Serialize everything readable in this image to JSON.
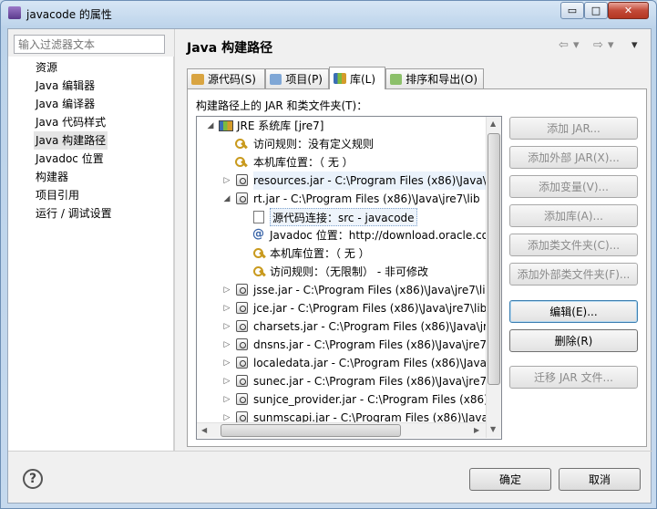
{
  "window": {
    "title": "javacode 的属性",
    "min_glyph": "▭",
    "max_glyph": "□",
    "close_glyph": "✕"
  },
  "filter": {
    "placeholder": "输入过滤器文本"
  },
  "nav": {
    "items": [
      "资源",
      "Java 编辑器",
      "Java 编译器",
      "Java 代码样式",
      "Java 构建路径",
      "Javadoc 位置",
      "构建器",
      "项目引用",
      "运行 / 调试设置"
    ],
    "selected": "Java 构建路径"
  },
  "page": {
    "title": "Java 构建路径",
    "back_glyph": "⇦",
    "fwd_glyph": "⇨",
    "menu_glyph": "▾"
  },
  "tabs": [
    "源代码(S)",
    "项目(P)",
    "库(L)",
    "排序和导出(O)"
  ],
  "active_tab": "库(L)",
  "libraries": {
    "label": "构建路径上的 JAR 和类文件夹(T)：",
    "jre": "JRE 系统库 [jre7]",
    "jre_access": "访问规则：没有定义规则",
    "jre_native": "本机库位置：（ 无 ）",
    "resources": "resources.jar  -  C:\\Program Files (x86)\\Java\\",
    "rt": "rt.jar  -  C:\\Program Files (x86)\\Java\\jre7\\lib",
    "rt_src": "源代码连接：src  -  javacode",
    "rt_javadoc": "Javadoc 位置：http://download.oracle.co",
    "rt_native": "本机库位置：（ 无 ）",
    "rt_access": "访问规则：（无限制）  -  非可修改",
    "jars": [
      "jsse.jar  -  C:\\Program Files (x86)\\Java\\jre7\\li",
      "jce.jar  -  C:\\Program Files (x86)\\Java\\jre7\\lib",
      "charsets.jar  -  C:\\Program Files (x86)\\Java\\jr",
      "dnsns.jar  -  C:\\Program Files (x86)\\Java\\jre7",
      "localedata.jar  -  C:\\Program Files (x86)\\Java\\",
      "sunec.jar  -  C:\\Program Files (x86)\\Java\\jre7",
      "sunjce_provider.jar  -  C:\\Program Files (x86)",
      "sunmscapi.jar  -  C:\\Program Files (x86)\\Java"
    ]
  },
  "buttons": {
    "add_jar": "添加 JAR...",
    "add_ext_jar": "添加外部 JAR(X)...",
    "add_var": "添加变量(V)...",
    "add_lib": "添加库(A)...",
    "add_class_folder": "添加类文件夹(C)...",
    "add_ext_class_folder": "添加外部类文件夹(F)...",
    "edit": "编辑(E)...",
    "remove": "删除(R)",
    "migrate": "迁移 JAR 文件..."
  },
  "footer": {
    "help": "?",
    "ok": "确定",
    "cancel": "取消"
  }
}
